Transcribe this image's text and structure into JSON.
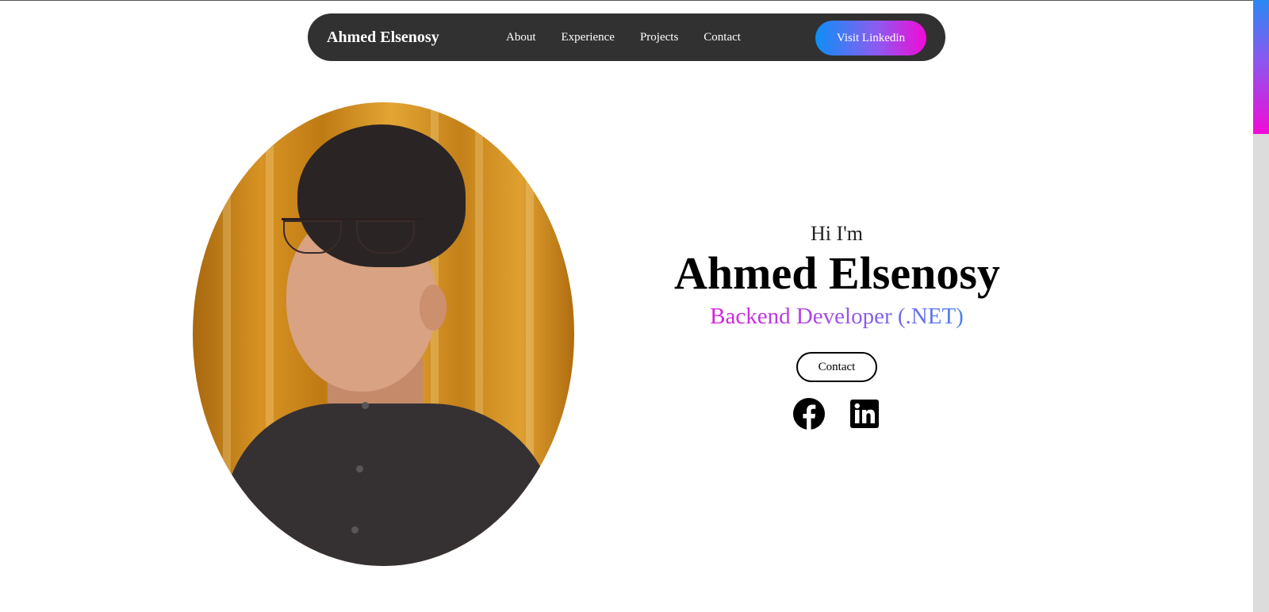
{
  "nav": {
    "brand": "Ahmed Elsenosy",
    "links": [
      "About",
      "Experience",
      "Projects",
      "Contact"
    ],
    "cta_label": "Visit Linkedin"
  },
  "hero": {
    "greeting": "Hi I'm",
    "name": "Ahmed Elsenosy",
    "role": "Backend Developer (.NET)",
    "contact_label": "Contact",
    "socials": [
      {
        "icon": "facebook-icon"
      },
      {
        "icon": "linkedin-icon"
      }
    ]
  },
  "colors": {
    "nav_bg": "#313131",
    "gradient_blue": "#0d8ff5",
    "gradient_pink": "#f20ad6"
  }
}
